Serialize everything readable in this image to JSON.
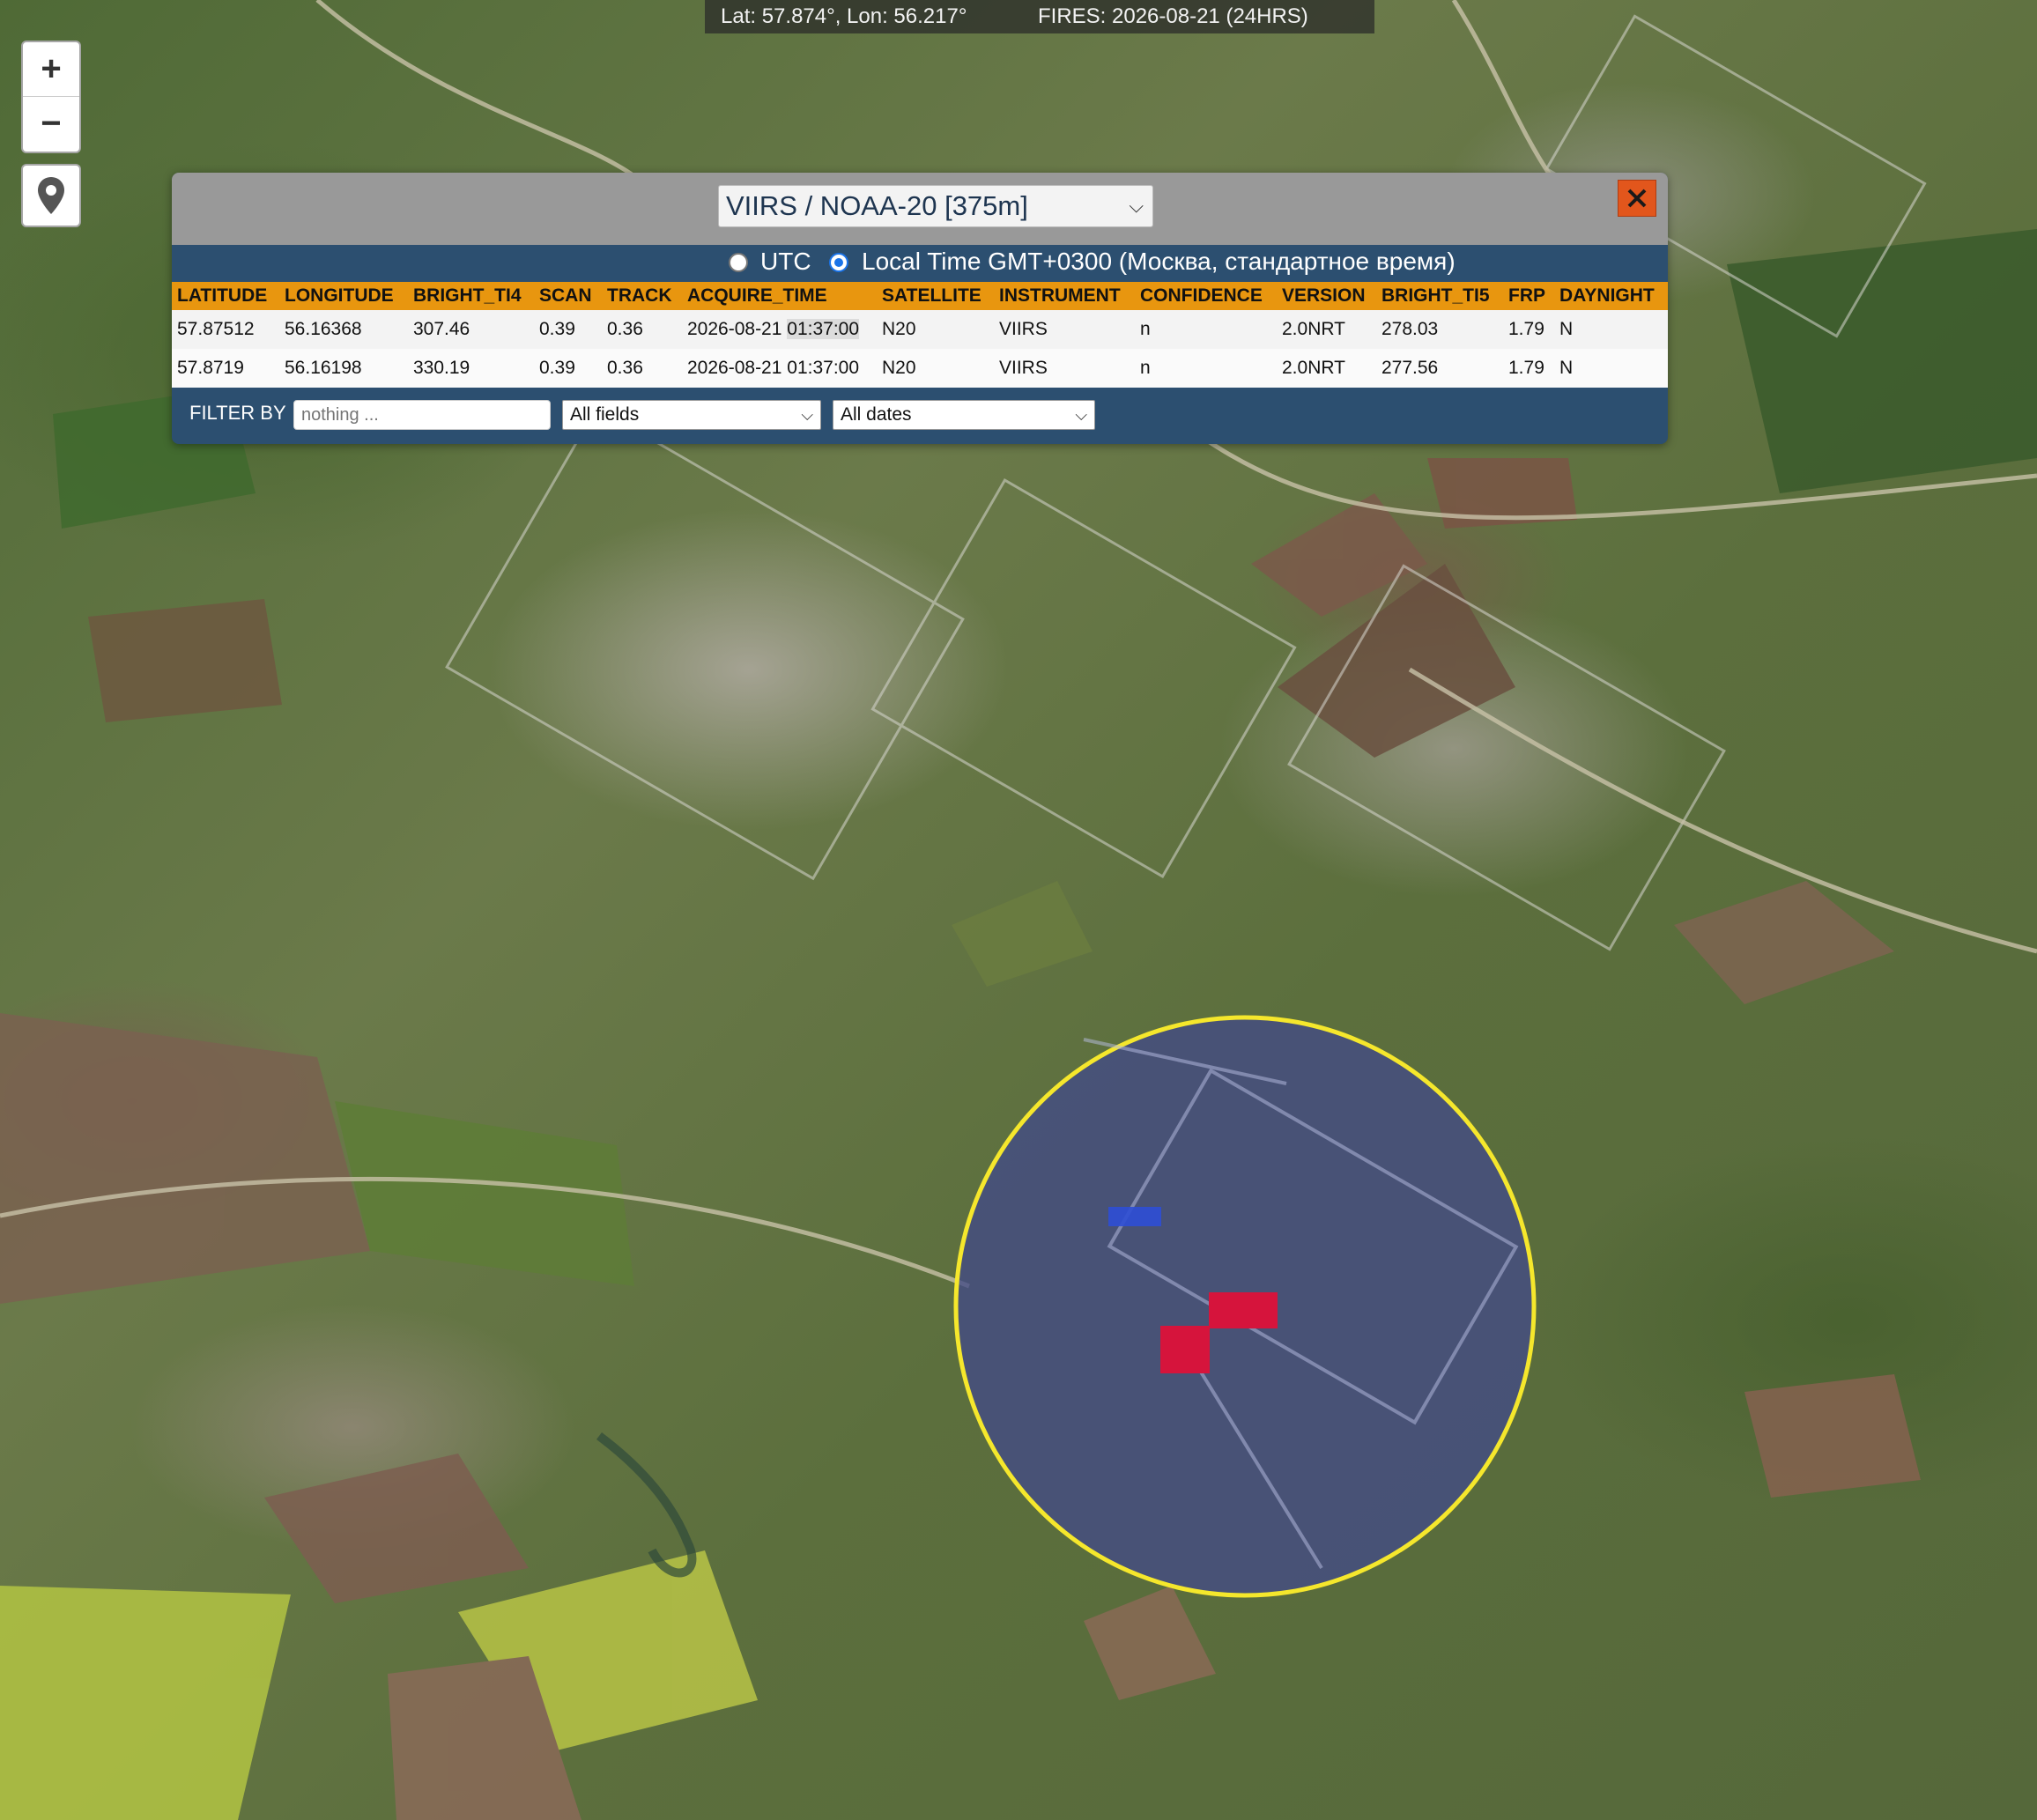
{
  "status_bar": {
    "coordinates": "Lat: 57.874°, Lon: 56.217°",
    "fires": "FIRES: 2026-08-21 (24HRS)"
  },
  "map_controls": {
    "zoom_in": "+",
    "zoom_out": "−",
    "locate_icon": "map-pin-icon"
  },
  "panel": {
    "sensor_selected": "VIIRS / NOAA-20 [375m]",
    "close_icon": "close-x-icon",
    "timezone": {
      "utc_label": "UTC",
      "local_label": "Local Time GMT+0300 (Москва, стандартное время)",
      "selected": "local"
    },
    "columns": [
      "LATITUDE",
      "LONGITUDE",
      "BRIGHT_TI4",
      "SCAN",
      "TRACK",
      "ACQUIRE_TIME",
      "SATELLITE",
      "INSTRUMENT",
      "CONFIDENCE",
      "VERSION",
      "BRIGHT_TI5",
      "FRP",
      "DAYNIGHT"
    ],
    "rows": [
      {
        "latitude": "57.87512",
        "longitude": "56.16368",
        "bright_ti4": "307.46",
        "scan": "0.39",
        "track": "0.36",
        "acq_date": "2026-08-21",
        "acq_time": "01:37:00",
        "satellite": "N20",
        "instrument": "VIIRS",
        "confidence": "n",
        "version": "2.0NRT",
        "bright_ti5": "278.03",
        "frp": "1.79",
        "daynight": "N"
      },
      {
        "latitude": "57.8719",
        "longitude": "56.16198",
        "bright_ti4": "330.19",
        "scan": "0.39",
        "track": "0.36",
        "acq_date": "2026-08-21",
        "acq_time": "01:37:00",
        "satellite": "N20",
        "instrument": "VIIRS",
        "confidence": "n",
        "version": "2.0NRT",
        "bright_ti5": "277.56",
        "frp": "1.79",
        "daynight": "N"
      }
    ],
    "filter": {
      "label": "FILTER BY",
      "placeholder": "nothing ...",
      "field_selected": "All fields",
      "date_selected": "All dates"
    }
  },
  "map_overlay": {
    "highlight_circle_color": "#f5e72c",
    "fire_pixel_color": "#d6143c"
  }
}
